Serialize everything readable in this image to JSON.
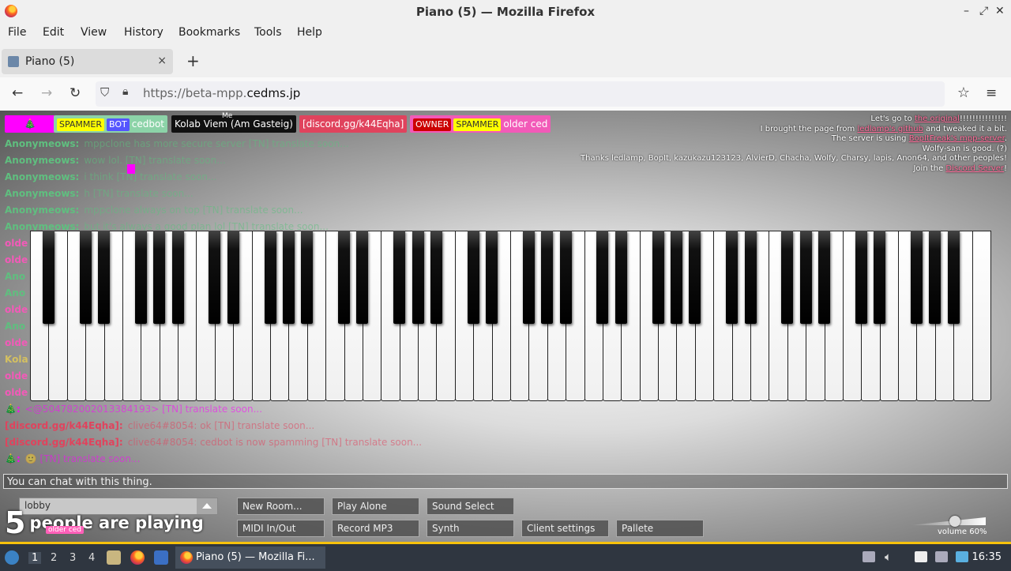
{
  "window": {
    "title": "Piano (5) — Mozilla Firefox"
  },
  "menu": [
    "File",
    "Edit",
    "View",
    "History",
    "Bookmarks",
    "Tools",
    "Help"
  ],
  "tab": {
    "label": "Piano (5)",
    "close": "×",
    "new": "+"
  },
  "url": {
    "prefix": "https://beta-mpp.",
    "domain": "cedms.jp"
  },
  "userbar": {
    "me_label": "Me",
    "users": [
      {
        "name": "",
        "tags": [],
        "bg": "#ff00ff",
        "fg": "#ffffff",
        "icon": "🎄"
      },
      {
        "name": "cedbot",
        "tags": [
          {
            "text": "SPAMMER",
            "bg": "#ffff00",
            "fg": "#333"
          },
          {
            "text": "BOT",
            "bg": "#5555ff",
            "fg": "#fff"
          }
        ],
        "bg": "#8cd3a8",
        "fg": "#ffffff"
      },
      {
        "name": "Kolab Viem (Am Gasteig)",
        "tags": [],
        "bg": "#111111",
        "fg": "#ffffff"
      },
      {
        "name": "[discord.gg/k44Eqha]",
        "tags": [],
        "bg": "#e0435d",
        "fg": "#ffffff"
      },
      {
        "name": "older ced",
        "tags": [
          {
            "text": "OWNER",
            "bg": "#cc0000",
            "fg": "#fff"
          },
          {
            "text": "SPAMMER",
            "bg": "#ffff00",
            "fg": "#333"
          }
        ],
        "bg": "#f25ab8",
        "fg": "#ffffff"
      }
    ]
  },
  "credits": {
    "l1a": "Let's go to ",
    "l1b": "the original",
    "l1c": "!!!!!!!!!!!!!!!",
    "l2a": "I brought the page from ",
    "l2b": "ledlamp's github",
    "l2c": " and tweaked it a bit.",
    "l3a": "The server is using ",
    "l3b": "BopItFreak's mpp-server",
    "l3c": ".",
    "l4": "Wolfy-san is good. (?)",
    "l5": "Thanks ledlamp, BopIt, kazukazu123123, AlvierD, Chacha, Wolfy, Charsy, lapis, Anon64, and other peoples!",
    "l6a": "Join the ",
    "l6b": "Discord Server",
    "l6c": "!"
  },
  "chat": [
    {
      "name": "Anonymeows:",
      "msg": "mppclone has more secure server [TN] translate soon...",
      "color": "#5fbf7f"
    },
    {
      "name": "Anonymeows:",
      "msg": "wow lol. [TN] translate soon...",
      "color": "#5fbf7f"
    },
    {
      "name": "Anonymeows:",
      "msg": "i think [TN] translate soon...",
      "color": "#5fbf7f"
    },
    {
      "name": "Anonymeows:",
      "msg": "h [TN] translate soon...",
      "color": "#5fbf7f"
    },
    {
      "name": "Anonymeows:",
      "msg": "mppclone always on top [TN] translate soon...",
      "color": "#5fbf7f"
    },
    {
      "name": "Anonymeows:",
      "msg": "but it's always a good plan lol [TN] translate soon...",
      "color": "#5fbf7f"
    },
    {
      "name": "olde",
      "msg": "",
      "color": "#f25ab8"
    },
    {
      "name": "olde",
      "msg": "",
      "color": "#f25ab8"
    },
    {
      "name": "Ano",
      "msg": "",
      "color": "#5fbf7f"
    },
    {
      "name": "Ano",
      "msg": "",
      "color": "#5fbf7f"
    },
    {
      "name": "olde",
      "msg": "",
      "color": "#f25ab8"
    },
    {
      "name": "Ano",
      "msg": "",
      "color": "#5fbf7f"
    },
    {
      "name": "olde",
      "msg": "",
      "color": "#f25ab8"
    },
    {
      "name": "Kola",
      "msg": "",
      "color": "#d4c060"
    },
    {
      "name": "olde",
      "msg": "",
      "color": "#f25ab8"
    },
    {
      "name": "olde",
      "msg": "",
      "color": "#f25ab8"
    },
    {
      "name": "🎄:",
      "msg": "<@504782002013384193> [TN] translate soon...",
      "color": "#ff00ff"
    },
    {
      "name": "[discord.gg/k44Eqha]:",
      "msg": "clive64#8054: ok [TN] translate soon...",
      "color": "#e0435d"
    },
    {
      "name": "[discord.gg/k44Eqha]:",
      "msg": "clive64#8054: cedbot is now spamming [TN] translate soon...",
      "color": "#e0435d"
    },
    {
      "name": "🎄:",
      "msg": "🙂 [TN] translate soon...",
      "color": "#ff00ff"
    }
  ],
  "chat_placeholder": "You can chat with this thing.",
  "room": {
    "value": "lobby"
  },
  "buttons": {
    "new_room": "New Room...",
    "play_alone": "Play Alone",
    "sound_select": "Sound Select",
    "midi": "MIDI In/Out",
    "record": "Record MP3",
    "synth": "Synth",
    "client_settings": "Client settings",
    "pallete": "Pallete"
  },
  "players": {
    "count": "5",
    "text": "people are playing"
  },
  "cursor_label": "older ced",
  "volume": {
    "label": "volume 60%",
    "level": 0.6
  },
  "piano": {
    "white_keys": 52
  },
  "taskbar": {
    "workspaces": [
      "1",
      "2",
      "3",
      "4"
    ],
    "window_label": "Piano (5) — Mozilla Fi...",
    "clock": "16:35"
  }
}
